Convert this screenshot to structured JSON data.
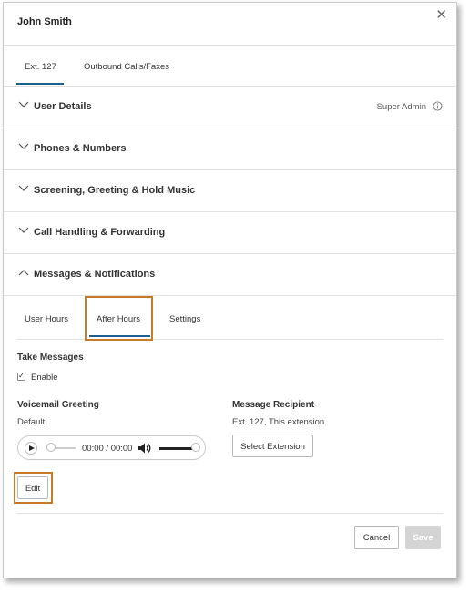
{
  "dialog": {
    "title": "John Smith",
    "close_icon": "close-icon"
  },
  "tabs": [
    {
      "label": "Ext. 127",
      "selected": true
    },
    {
      "label": "Outbound Calls/Faxes",
      "selected": false
    }
  ],
  "sections": [
    {
      "label": "User Details",
      "expanded": false,
      "badge": "Super Admin"
    },
    {
      "label": "Phones & Numbers",
      "expanded": false
    },
    {
      "label": "Screening, Greeting & Hold Music",
      "expanded": false
    },
    {
      "label": "Call Handling & Forwarding",
      "expanded": false
    },
    {
      "label": "Messages & Notifications",
      "expanded": true
    }
  ],
  "subtabs": [
    {
      "label": "User Hours",
      "selected": false
    },
    {
      "label": "After Hours",
      "selected": true
    },
    {
      "label": "Settings",
      "selected": false
    }
  ],
  "take_messages": {
    "title": "Take Messages",
    "enable_label": "Enable",
    "checked": true
  },
  "voicemail_greeting": {
    "title": "Voicemail Greeting",
    "value": "Default",
    "time": "00:00 / 00:00",
    "edit_label": "Edit"
  },
  "message_recipient": {
    "title": "Message Recipient",
    "value": "Ext. 127, This extension",
    "select_label": "Select Extension"
  },
  "footer": {
    "cancel_label": "Cancel",
    "save_label": "Save"
  },
  "colors": {
    "accent": "#1b5f8f",
    "highlight": "#c97a27",
    "save_disabled": "#d4d4d4"
  }
}
